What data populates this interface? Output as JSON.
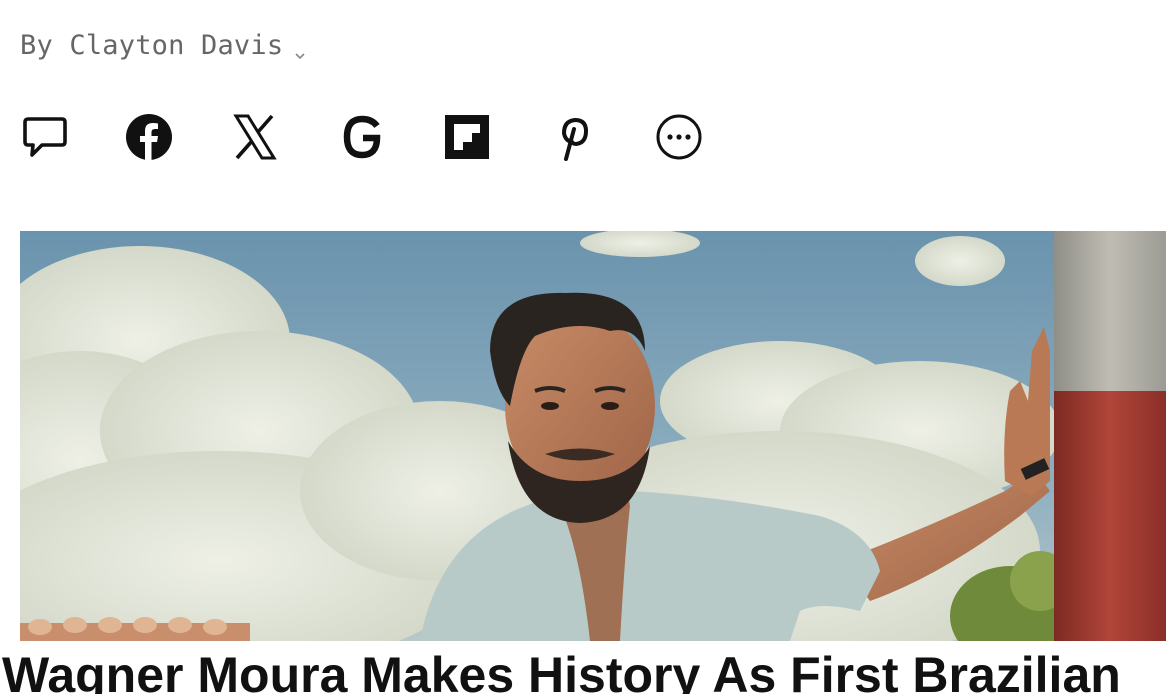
{
  "article": {
    "byline": "By Clayton Davis",
    "headline": "Wagner Moura Makes History As First Brazilian"
  },
  "share": {
    "items": [
      {
        "icon": "comment-icon"
      },
      {
        "icon": "facebook-icon"
      },
      {
        "icon": "x-icon"
      },
      {
        "icon": "google-icon"
      },
      {
        "icon": "flipboard-icon"
      },
      {
        "icon": "pinterest-icon"
      },
      {
        "icon": "more-icon"
      }
    ]
  },
  "hero_image": {
    "alt": "",
    "colors": {
      "sky": "#6f96ad",
      "cloud": "#dfe3d8",
      "shirt": "#b9cbc8",
      "pole_red": "#a83a2f",
      "pole_grey": "#a7a9a4"
    }
  }
}
